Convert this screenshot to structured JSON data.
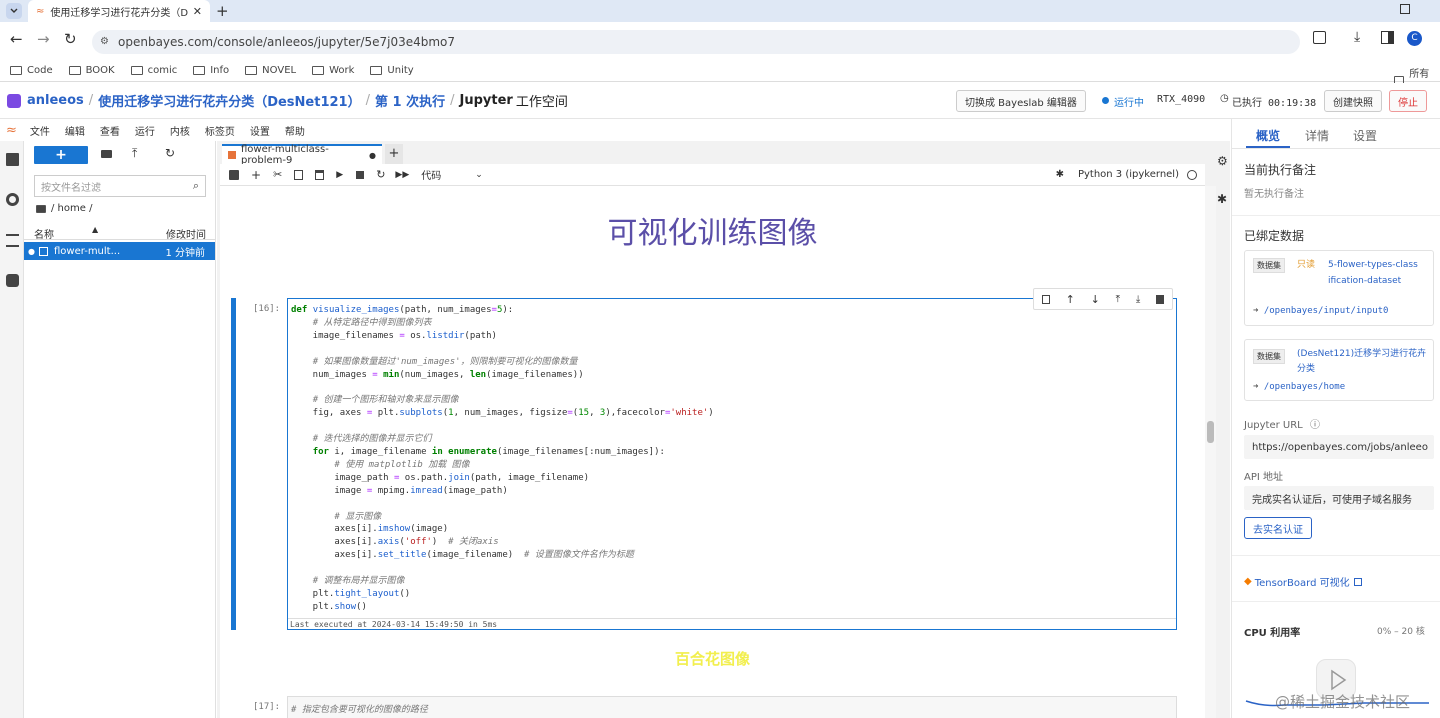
{
  "browser": {
    "tab_title": "使用迁移学习进行花卉分类（D",
    "new_tab": "+",
    "url": "openbayes.com/console/anleeos/jupyter/5e7j03e4bmo7",
    "profile_initial": "C",
    "bookmarks": [
      "Code",
      "BOOK",
      "comic",
      "Info",
      "NOVEL",
      "Work",
      "Unity"
    ],
    "bookmarks_right": "所有书"
  },
  "header": {
    "user": "anleeos",
    "project": "使用迁移学习进行花卉分类（DesNet121）",
    "run": "第 1 次执行",
    "workspace": "Jupyter",
    "workspace_suffix": "工作空间",
    "switch_editor": "切换成 Bayeslab 编辑器",
    "status": "运行中",
    "gpu": "RTX_4090",
    "elapsed": "已执行 00:19:38",
    "snapshot": "创建快照",
    "stop": "停止"
  },
  "menu": [
    "文件",
    "编辑",
    "查看",
    "运行",
    "内核",
    "标签页",
    "设置",
    "帮助"
  ],
  "filebrowser": {
    "new": "+",
    "filter_placeholder": "按文件名过滤",
    "path": "/ home /",
    "col_name": "名称",
    "col_modified": "修改时间",
    "file_name": "flower-mult...",
    "file_modified": "1 分钟前"
  },
  "notebook": {
    "tab_name": "flower-multiclass-problem-9",
    "cell_type": "代码",
    "kernel": "Python 3 (ipykernel)",
    "heading": "可视化训练图像",
    "prompt16": "[16]:",
    "exec_info": "Last executed at 2024-03-14 15:49:50 in 5ms",
    "lily_heading": "百合花图像",
    "prompt17": "[17]:",
    "cell17_comment": "# 指定包含要可视化的图像的路径"
  },
  "rightpanel": {
    "tabs": [
      "概览",
      "详情",
      "设置"
    ],
    "current_note_title": "当前执行备注",
    "current_note_value": "暂无执行备注",
    "bound_data_title": "已绑定数据",
    "ds1_badge": "数据集",
    "ds1_readonly": "只读",
    "ds1_name": "5-flower-types-classification-dataset",
    "ds1_path": "/openbayes/input/input0",
    "ds2_badge": "数据集",
    "ds2_name": "(DesNet121)迁移学习进行花卉分类",
    "ds2_path": "/openbayes/home",
    "jupyter_url_label": "Jupyter URL",
    "jupyter_url": "https://openbayes.com/jobs/anleeo",
    "api_label": "API 地址",
    "api_value": "完成实名认证后，可使用子域名服务",
    "verify_button": "去实名认证",
    "tensorboard": "TensorBoard 可视化",
    "cpu_label": "CPU 利用率",
    "cpu_range": "0% – 20 核"
  },
  "watermark": "@稀土掘金技术社区",
  "colors": {
    "accent": "#1976d2",
    "link": "#2b63c6",
    "heading": "#5b4fa8",
    "lily": "#f2ef4e",
    "stop": "#d33"
  }
}
